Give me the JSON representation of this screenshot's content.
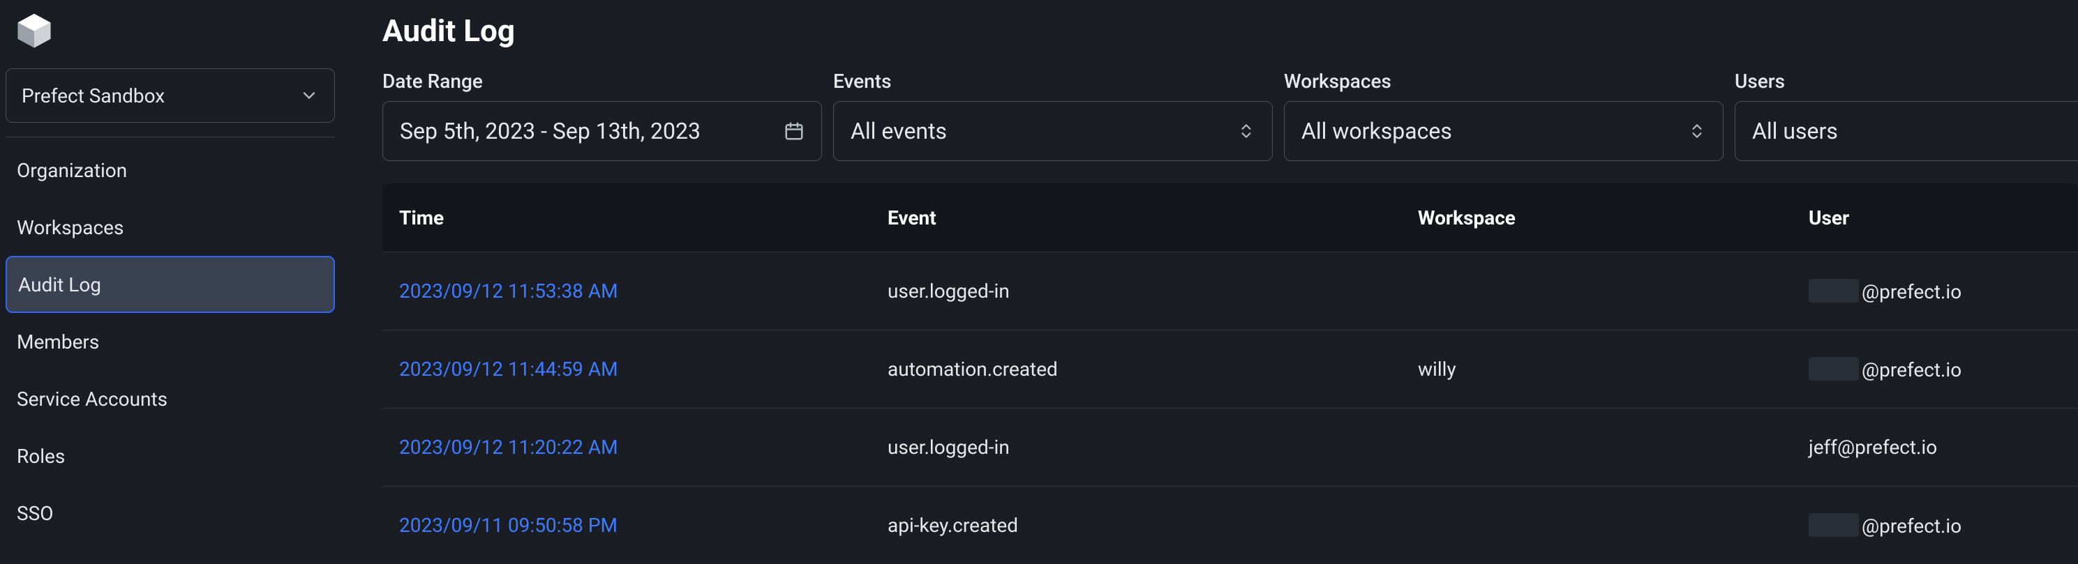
{
  "sidebar": {
    "workspace_label": "Prefect Sandbox",
    "items": [
      {
        "label": "Organization",
        "active": false
      },
      {
        "label": "Workspaces",
        "active": false
      },
      {
        "label": "Audit Log",
        "active": true
      },
      {
        "label": "Members",
        "active": false
      },
      {
        "label": "Service Accounts",
        "active": false
      },
      {
        "label": "Roles",
        "active": false
      },
      {
        "label": "SSO",
        "active": false
      }
    ]
  },
  "page_title": "Audit Log",
  "filters": {
    "date_range": {
      "label": "Date Range",
      "value": "Sep 5th, 2023 - Sep 13th, 2023"
    },
    "events": {
      "label": "Events",
      "value": "All events"
    },
    "workspaces": {
      "label": "Workspaces",
      "value": "All workspaces"
    },
    "users": {
      "label": "Users",
      "value": "All users"
    }
  },
  "table": {
    "columns": {
      "time": "Time",
      "event": "Event",
      "workspace": "Workspace",
      "user": "User"
    },
    "rows": [
      {
        "time": "2023/09/12 11:53:38 AM",
        "event": "user.logged-in",
        "workspace": "",
        "user_suffix": "@prefect.io",
        "user_prefix_redacted": true
      },
      {
        "time": "2023/09/12 11:44:59 AM",
        "event": "automation.created",
        "workspace": "willy",
        "user_suffix": "@prefect.io",
        "user_prefix_redacted": true
      },
      {
        "time": "2023/09/12 11:20:22 AM",
        "event": "user.logged-in",
        "workspace": "",
        "user_full": "jeff@prefect.io"
      },
      {
        "time": "2023/09/11 09:50:58 PM",
        "event": "api-key.created",
        "workspace": "",
        "user_suffix": "@prefect.io",
        "user_prefix_redacted": true
      }
    ]
  }
}
